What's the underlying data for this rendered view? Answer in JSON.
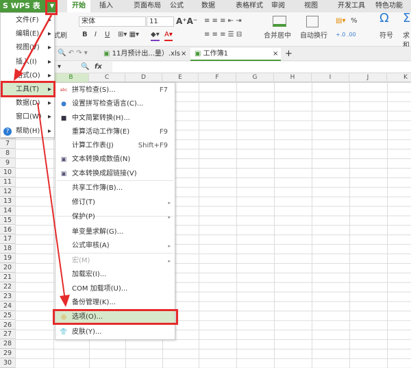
{
  "app": {
    "logo": "S WPS 表格",
    "dropdown_icon": "caret-down-icon"
  },
  "ribbon_tabs": [
    "开始",
    "插入",
    "页面布局",
    "公式",
    "数据",
    "表格样式",
    "审阅",
    "视图",
    "开发工具",
    "特色功能"
  ],
  "ribbon": {
    "format_painter": "式刷",
    "font_name": "宋体",
    "font_size": "11",
    "merge_center": "合并居中",
    "wrap_text": "自动换行",
    "symbol": "符号",
    "sum": "求和",
    "percent": "%",
    "bold": "B",
    "italic": "I",
    "underline": "U",
    "omega": "Ω",
    "sigma": "Σ"
  },
  "doc_tabs": [
    {
      "label": "11月预计出...量）.xls",
      "close": "×"
    },
    {
      "label": "工作簿1",
      "close": "×"
    }
  ],
  "new_tab": "+",
  "formula_bar": {
    "fx": "fx"
  },
  "columns": [
    "B",
    "C",
    "D",
    "E",
    "F",
    "G",
    "H",
    "I",
    "J",
    "K"
  ],
  "rows": [
    "7",
    "8",
    "9",
    "10",
    "11",
    "12",
    "13",
    "14",
    "15",
    "16",
    "17",
    "18",
    "19",
    "20",
    "21",
    "22",
    "23",
    "24",
    "25",
    "26",
    "27",
    "28",
    "29",
    "30"
  ],
  "menu": [
    {
      "label": "文件(F)"
    },
    {
      "label": "编辑(E)"
    },
    {
      "label": "视图(V)"
    },
    {
      "label": "插入(I)"
    },
    {
      "label": "格式(O)"
    },
    {
      "label": "工具(T)",
      "highlighted": true
    },
    {
      "label": "数据(D)"
    },
    {
      "label": "窗口(W)"
    },
    {
      "label": "帮助(H)"
    }
  ],
  "submenu": [
    {
      "label": "拼写检查(S)...",
      "shortcut": "F7",
      "icon": "spellcheck-icon"
    },
    {
      "label": "设置拼写检查语言(C)...",
      "icon": "language-icon"
    },
    {
      "label": "中文简繁转换(H)...",
      "icon": "chinese-convert-icon"
    },
    {
      "label": "重算活动工作簿(E)",
      "shortcut": "F9"
    },
    {
      "label": "计算工作表(J)",
      "shortcut": "Shift+F9"
    },
    {
      "label": "文本转换成数值(N)",
      "icon": "text-to-number-icon"
    },
    {
      "label": "文本转换成超链接(V)",
      "icon": "text-to-link-icon"
    },
    {
      "label": "共享工作簿(B)..."
    },
    {
      "label": "修订(T)",
      "submenu": true
    },
    {
      "label": "保护(P)",
      "submenu": true
    },
    {
      "label": "单变量求解(G)..."
    },
    {
      "label": "公式审核(A)",
      "submenu": true
    },
    {
      "label": "宏(M)",
      "submenu": true,
      "disabled": true
    },
    {
      "label": "加载宏(I)..."
    },
    {
      "label": "COM 加载项(U)..."
    },
    {
      "label": "备份管理(K)..."
    },
    {
      "label": "选项(O)...",
      "icon": "options-gear-icon",
      "highlighted": true
    },
    {
      "label": "皮肤(Y)...",
      "icon": "skin-shirt-icon"
    }
  ],
  "colors": {
    "accent": "#4c9a3c",
    "highlight": "#d7e9cb",
    "annotation": "#e52b2b"
  }
}
